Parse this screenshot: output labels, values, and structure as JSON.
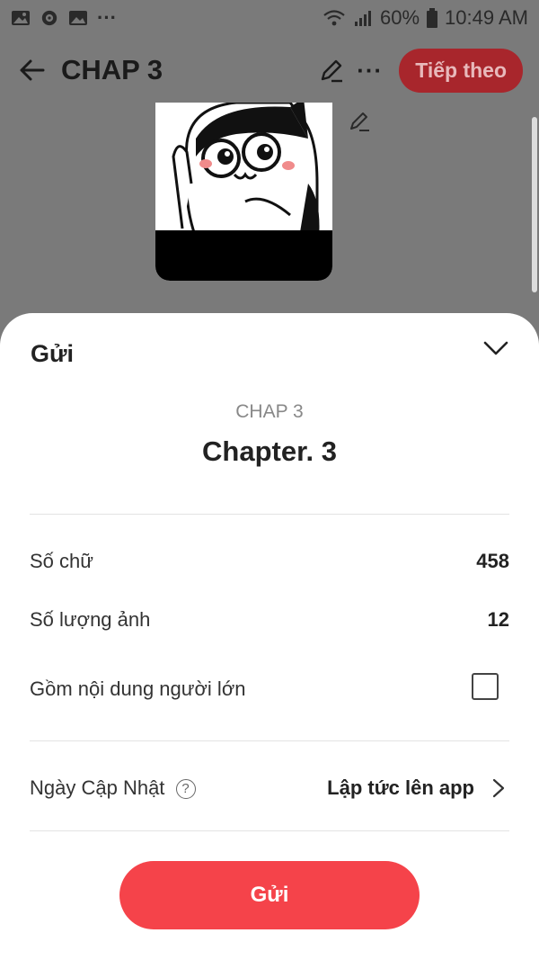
{
  "status_bar": {
    "battery": "60%",
    "time": "10:49 AM",
    "dots": "···"
  },
  "header": {
    "title": "CHAP 3",
    "next_label": "Tiếp theo"
  },
  "sheet": {
    "title": "Gửi",
    "chapter_label": "CHAP 3",
    "chapter_name": "Chapter. 3",
    "rows": [
      {
        "label": "Số chữ",
        "value": "458"
      },
      {
        "label": "Số lượng ảnh",
        "value": "12"
      },
      {
        "label": "Gồm nội dung người lớn",
        "checked": false
      }
    ],
    "update": {
      "label": "Ngày Cập Nhật",
      "help": "?",
      "value": "Lập tức lên app"
    },
    "submit_label": "Gửi"
  },
  "colors": {
    "accent": "#f5434a",
    "dimmed_accent": "#a8262c",
    "overlay": "#7a7a7a"
  },
  "icons": [
    "gallery-icon",
    "compass-icon",
    "gallery-icon",
    "wifi-icon",
    "signal-icon",
    "battery-icon",
    "back-arrow-icon",
    "pencil-icon",
    "more-icon",
    "chevron-down-icon",
    "help-icon",
    "chevron-right-icon"
  ]
}
